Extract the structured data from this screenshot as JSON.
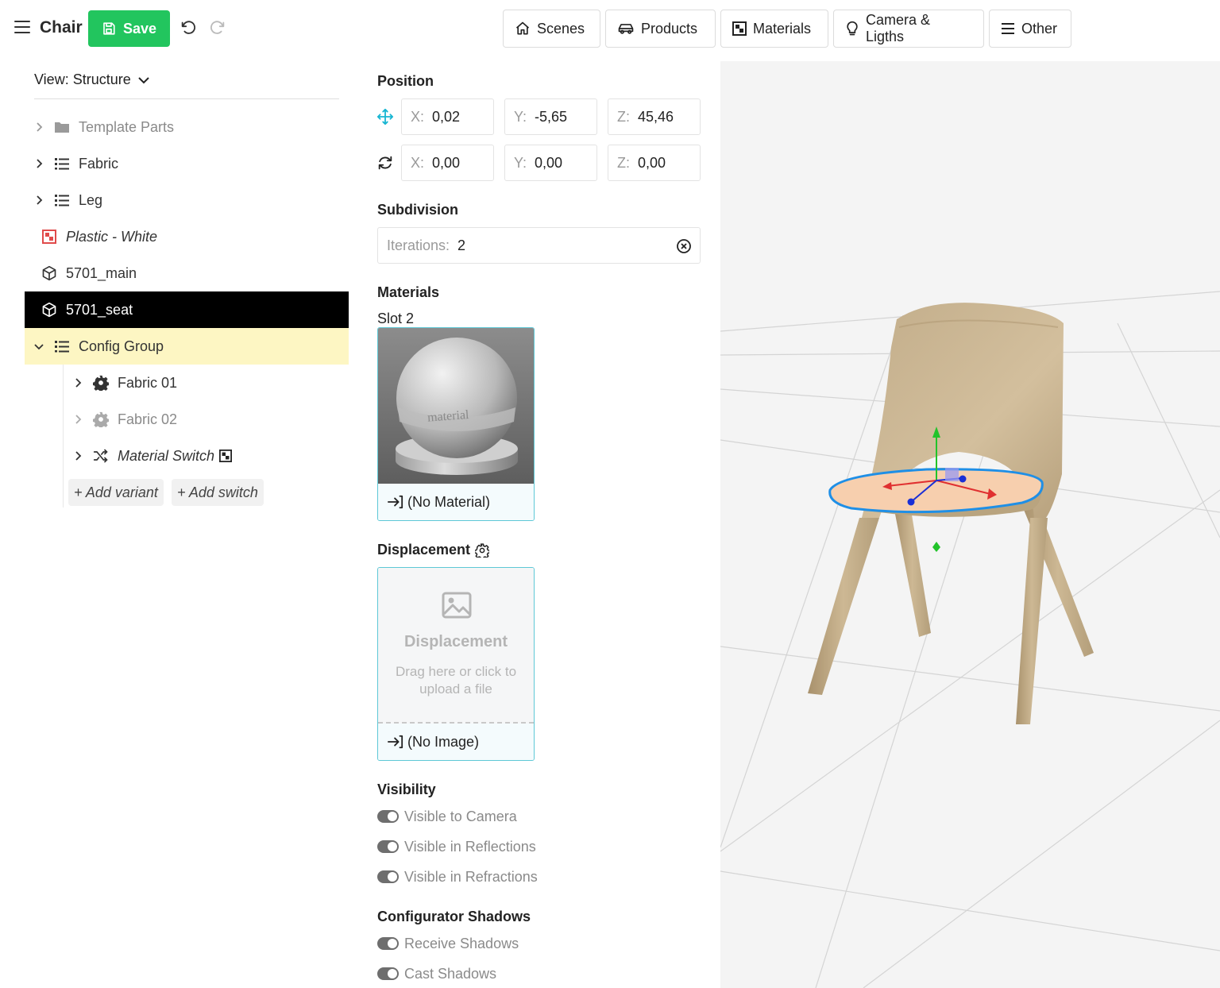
{
  "header": {
    "title": "Chair",
    "save_label": "Save",
    "nav": [
      {
        "label": "Scenes",
        "icon": "home-icon"
      },
      {
        "label": "Products",
        "icon": "car-icon"
      },
      {
        "label": "Materials",
        "icon": "material-icon"
      },
      {
        "label": "Camera & Ligths",
        "icon": "bulb-icon"
      },
      {
        "label": "Other",
        "icon": "menu-icon"
      }
    ]
  },
  "tree": {
    "view_label": "View: Structure",
    "items": [
      {
        "label": "Template Parts"
      },
      {
        "label": "Fabric"
      },
      {
        "label": "Leg"
      },
      {
        "label": "Plastic - White"
      },
      {
        "label": "5701_main"
      },
      {
        "label": "5701_seat"
      },
      {
        "label": "Config Group"
      },
      {
        "label": "Fabric 01"
      },
      {
        "label": "Fabric 02"
      },
      {
        "label": "Material Switch"
      }
    ],
    "add_variant": "+ Add variant",
    "add_switch": "+ Add switch"
  },
  "props": {
    "position_heading": "Position",
    "position": {
      "x": "0,02",
      "y": "-5,65",
      "z": "45,46"
    },
    "rotation": {
      "x": "0,00",
      "y": "0,00",
      "z": "0,00"
    },
    "axis": {
      "x": "X:",
      "y": "Y:",
      "z": "Z:"
    },
    "subdivision_heading": "Subdivision",
    "iterations_label": "Iterations:",
    "iterations_value": "2",
    "materials_heading": "Materials",
    "slot_label": "Slot 2",
    "material_text": "material",
    "no_material": "(No Material)",
    "displacement_heading": "Displacement",
    "displacement_title": "Displacement",
    "displacement_hint": "Drag here or click to upload a file",
    "no_image": "(No Image)",
    "visibility_heading": "Visibility",
    "visibility": [
      "Visible to Camera",
      "Visible in Reflections",
      "Visible in Refractions"
    ],
    "shadows_heading": "Configurator Shadows",
    "shadows": [
      "Receive Shadows",
      "Cast Shadows"
    ]
  },
  "colors": {
    "save": "#22c55e",
    "selected_row": "#000000",
    "highlight_row": "#fdf6c3",
    "card_border": "#5ec8d6",
    "move_icon": "#19b6d2"
  }
}
